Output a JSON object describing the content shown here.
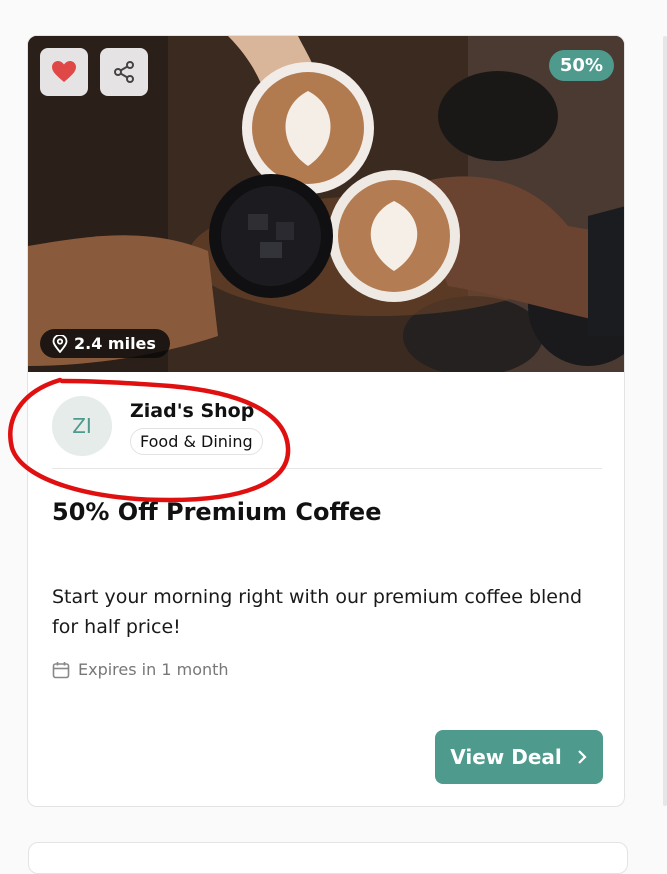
{
  "card": {
    "discount_badge": "50%",
    "distance": "2.4 miles",
    "shop": {
      "avatar_initials": "ZI",
      "name": "Ziad's Shop",
      "category": "Food & Dining"
    },
    "title": "50% Off Premium Coffee",
    "description": "Start your morning right with our premium coffee blend for half price!",
    "expiry": "Expires in 1 month",
    "cta_label": "View Deal"
  },
  "icons": {
    "favorite": "heart-icon",
    "share": "share-icon",
    "location": "map-pin-icon",
    "calendar": "calendar-icon",
    "chevron": "chevron-right-icon"
  },
  "colors": {
    "accent": "#4e9a8c",
    "favorite_heart": "#e04848",
    "annotation_circle": "#e01010"
  }
}
